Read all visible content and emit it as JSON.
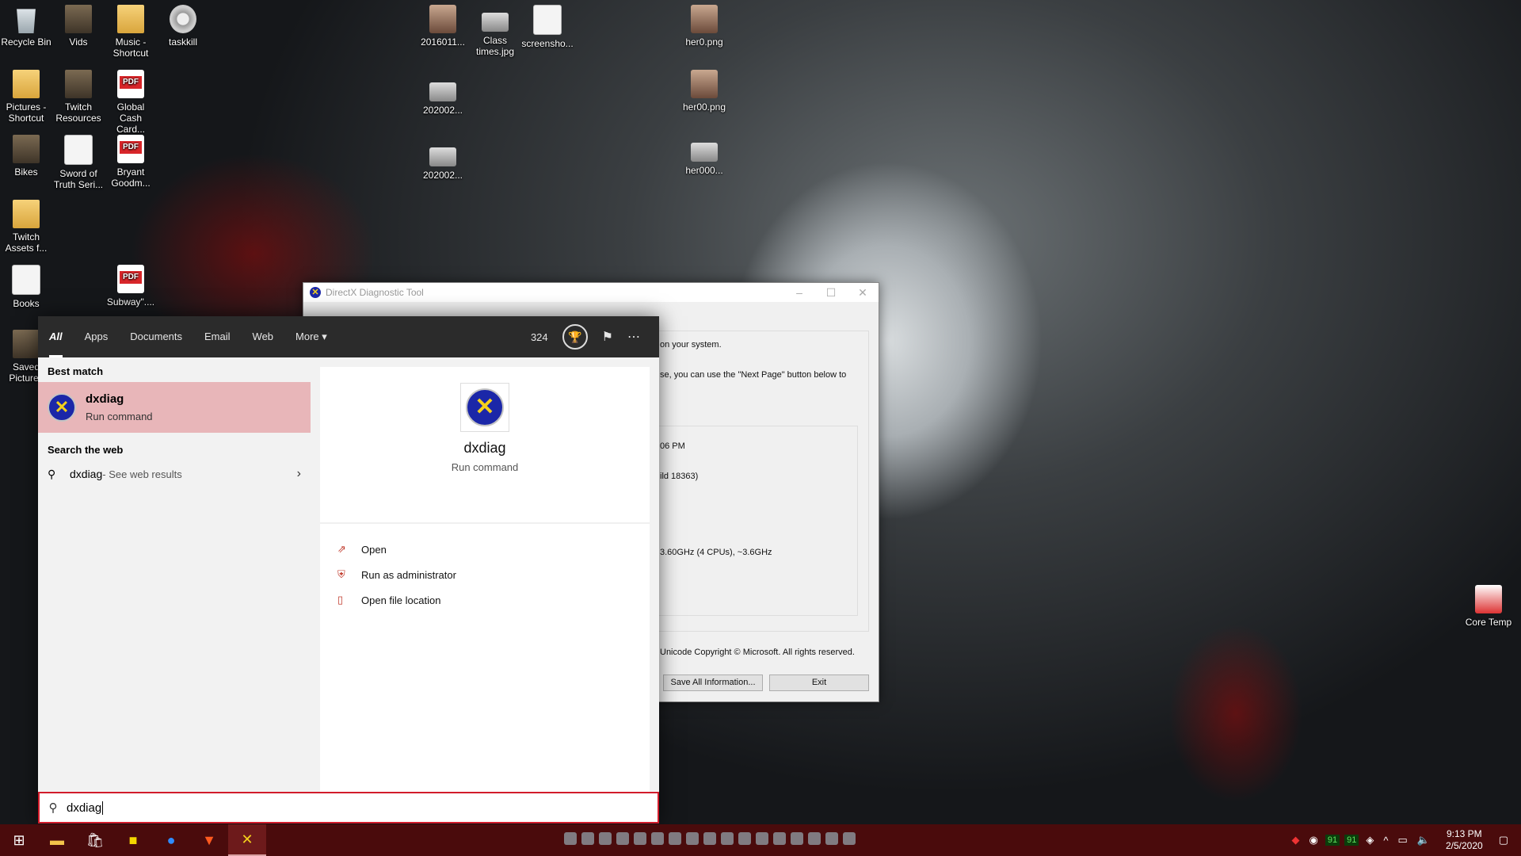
{
  "desktop_icons": [
    {
      "label": "Recycle Bin",
      "kind": "bin"
    },
    {
      "label": "Vids",
      "kind": "folder-dark"
    },
    {
      "label": "Music - Shortcut",
      "kind": "folder"
    },
    {
      "label": "taskkill",
      "kind": "gear"
    },
    {
      "label": "Pictures - Shortcut",
      "kind": "folder"
    },
    {
      "label": "Twitch Resources",
      "kind": "folder-dark"
    },
    {
      "label": "Global Cash Card...",
      "kind": "pdf"
    },
    {
      "label": "Bikes",
      "kind": "folder-dark"
    },
    {
      "label": "Sword of Truth Seri...",
      "kind": "doc"
    },
    {
      "label": "Bryant Goodm...",
      "kind": "pdf"
    },
    {
      "label": "Twitch Assets f...",
      "kind": "folder"
    },
    {
      "label": "Books",
      "kind": "doc"
    },
    {
      "label": "Subway\"....",
      "kind": "pdf"
    },
    {
      "label": "Saved Pictures",
      "kind": "folder-dark"
    },
    {
      "label": "2016011...",
      "kind": "photo"
    },
    {
      "label": "Class times.jpg",
      "kind": "shot"
    },
    {
      "label": "screensho...",
      "kind": "doc"
    },
    {
      "label": "202002...",
      "kind": "shot"
    },
    {
      "label": "202002...",
      "kind": "shot"
    },
    {
      "label": "her0.png",
      "kind": "photo"
    },
    {
      "label": "her00.png",
      "kind": "photo"
    },
    {
      "label": "her000...",
      "kind": "shot"
    },
    {
      "label": "Core Temp",
      "kind": "core"
    }
  ],
  "dxdiag_window": {
    "title": "DirectX Diagnostic Tool",
    "lines": [
      "on your system.",
      "se, you can use the \"Next Page\" button below to",
      "06 PM",
      "ild 18363)",
      "3.60GHz (4 CPUs), ~3.6GHz"
    ],
    "footer": "Unicode  Copyright © Microsoft. All rights reserved.",
    "save_btn": "Save All Information...",
    "exit_btn": "Exit"
  },
  "search_panel": {
    "tabs": [
      "All",
      "Apps",
      "Documents",
      "Email",
      "Web",
      "More"
    ],
    "more_arrow": "▾",
    "points": "324",
    "best_match_heading": "Best match",
    "best_match": {
      "name": "dxdiag",
      "type": "Run command"
    },
    "search_web_heading": "Search the web",
    "web_result": {
      "query": "dxdiag",
      "hint": " - See web results"
    },
    "detail": {
      "name": "dxdiag",
      "type": "Run command"
    },
    "actions": [
      "Open",
      "Run as administrator",
      "Open file location"
    ],
    "query": "dxdiag"
  },
  "taskbar": {
    "clock_time": "9:13 PM",
    "clock_date": "2/5/2020",
    "tray_num1": "91",
    "tray_num2": "91"
  }
}
